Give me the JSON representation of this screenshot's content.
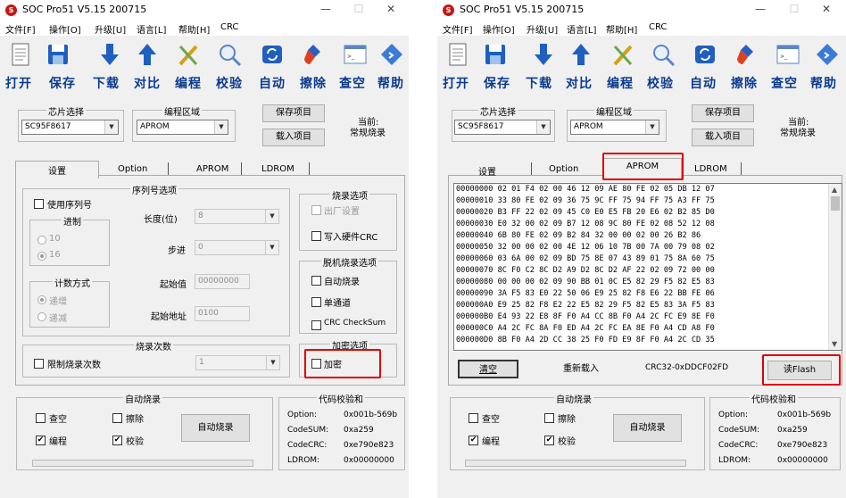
{
  "app": {
    "title": "SOC Pro51 V5.15 200715",
    "icon_text": "S"
  },
  "window_controls": {
    "minimize": "—",
    "maximize": "☐",
    "close": "✕"
  },
  "menu": [
    "文件[F]",
    "操作[O]",
    "升级[U]",
    "语言[L]",
    "帮助[H]",
    "CRC"
  ],
  "toolbar": [
    {
      "label": "打开",
      "icon": "open-doc-icon"
    },
    {
      "label": "保存",
      "icon": "save-disk-icon"
    },
    {
      "label": "下载",
      "icon": "download-arrow-icon"
    },
    {
      "label": "对比",
      "icon": "upload-arrow-icon"
    },
    {
      "label": "编程",
      "icon": "program-wand-icon"
    },
    {
      "label": "校验",
      "icon": "verify-magnifier-icon"
    },
    {
      "label": "自动",
      "icon": "auto-refresh-icon"
    },
    {
      "label": "擦除",
      "icon": "erase-brush-icon"
    },
    {
      "label": "查空",
      "icon": "blank-check-console-icon"
    },
    {
      "label": "帮助",
      "icon": "help-diamond-icon"
    }
  ],
  "chip": {
    "label": "芯片选择",
    "value": "SC95F8617"
  },
  "region": {
    "label": "编程区域",
    "value": "APROM"
  },
  "buttons": {
    "save_project": "保存项目",
    "load_project": "载入项目",
    "auto_program": "自动烧录",
    "clear": "清空",
    "reload": "重新载入",
    "read_flash": "读Flash"
  },
  "current": {
    "line1": "当前:",
    "line2": "常规烧录"
  },
  "tabs": [
    "设置",
    "Option",
    "APROM",
    "LDROM"
  ],
  "settings": {
    "serial_group": "序列号选项",
    "use_serial": "使用序列号",
    "radix_group": "进制",
    "radix_options": [
      "10",
      "16"
    ],
    "length_label": "长度(位)",
    "length_value": "8",
    "step_label": "步进",
    "step_value": "0",
    "start_label": "起始值",
    "start_value": "00000000",
    "addr_label": "起始地址",
    "addr_value": "0100",
    "count_group": "计数方式",
    "count_options": [
      "递增",
      "递减"
    ],
    "times_group": "烧录次数",
    "limit_times": "限制烧录次数",
    "times_value": "1",
    "burn_group": "烧录选项",
    "factory_setting": "出厂设置",
    "write_crc": "写入硬件CRC",
    "offline_group": "脱机烧录选项",
    "auto_burn": "自动烧录",
    "single_channel": "单通道",
    "crc_checksum": "CRC CheckSum",
    "encrypt_group": "加密选项",
    "encrypt": "加密"
  },
  "hex": {
    "lines": [
      "00000000 02 01 F4 02 00 46 12 09 AE 80 FE 02 05 DB 12 07",
      "00000010 33 80 FE 02 09 36 75 9C FF 75 94 FF 75 A3 FF 75",
      "00000020 B3 FF 22 02 09 45 C0 E0 E5 FB 20 E6 02 B2 85 D0",
      "00000030 E0 32 00 02 09 B7 12 08 9C 80 FE 02 08 52 12 08",
      "00000040 6B 80 FE 02 09 B2 84 32 00 00 02 00 26 B2 86",
      "00000050 32 00 00 02 00 4E 12 06 10 7B 00 7A 00 79 08 02",
      "00000060 03 6A 00 02 09 BD 75 8E 07 43 89 01 75 8A 60 75",
      "00000070 8C F0 C2 8C D2 A9 D2 8C D2 AF 22 02 09 72 00 00",
      "00000080 00 00 00 02 09 90 BB 01 0C E5 82 29 F5 82 E5 83",
      "00000090 3A F5 83 E0 22 50 06 E9 25 82 F8 E6 22 BB FE 06",
      "000000A0 E9 25 82 F8 E2 22 E5 82 29 F5 82 E5 83 3A F5 83",
      "000000B0 E4 93 22 E8 8F F0 A4 CC 8B F0 A4 2C FC E9 8E F0",
      "000000C0 A4 2C FC 8A F0 ED A4 2C FC EA 8E F0 A4 CD A8 F0",
      "000000D0 8B F0 A4 2D CC 38 25 F0 FD E9 8F F0 A4 2C CD 35"
    ]
  },
  "crc_display": "CRC32-0xDDCF02FD",
  "auto_group": {
    "title": "自动烧录",
    "check_blank": "查空",
    "erase": "擦除",
    "program": "编程",
    "verify": "校验"
  },
  "checksum": {
    "title": "代码校验和",
    "rows": [
      {
        "label": "Option:",
        "value": "0x001b-569b"
      },
      {
        "label": "CodeSUM:",
        "value": "0xa259"
      },
      {
        "label": "CodeCRC:",
        "value": "0xe790e823"
      },
      {
        "label": "LDROM:",
        "value": "0x00000000"
      }
    ]
  },
  "colors": {
    "toolbar_label": "#0a3a8e",
    "highlight": "#e00000",
    "window_bg": "#f0f0f0"
  }
}
